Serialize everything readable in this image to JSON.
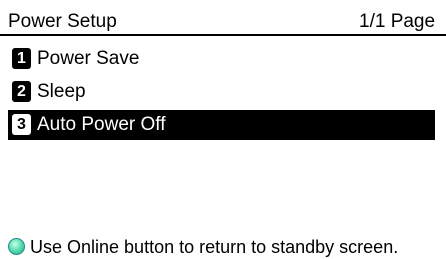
{
  "header": {
    "title": "Power Setup",
    "page_indicator": "1/1 Page"
  },
  "menu": {
    "items": [
      {
        "number": "1",
        "label": "Power Save",
        "selected": false
      },
      {
        "number": "2",
        "label": "Sleep",
        "selected": false
      },
      {
        "number": "3",
        "label": "Auto Power Off",
        "selected": true
      }
    ]
  },
  "footer": {
    "icon": "online-button-icon",
    "message": "Use Online button to return to standby screen."
  },
  "colors": {
    "selected_background": "#000000",
    "selected_text": "#ffffff",
    "online_indicator": "#5ee0b4"
  }
}
